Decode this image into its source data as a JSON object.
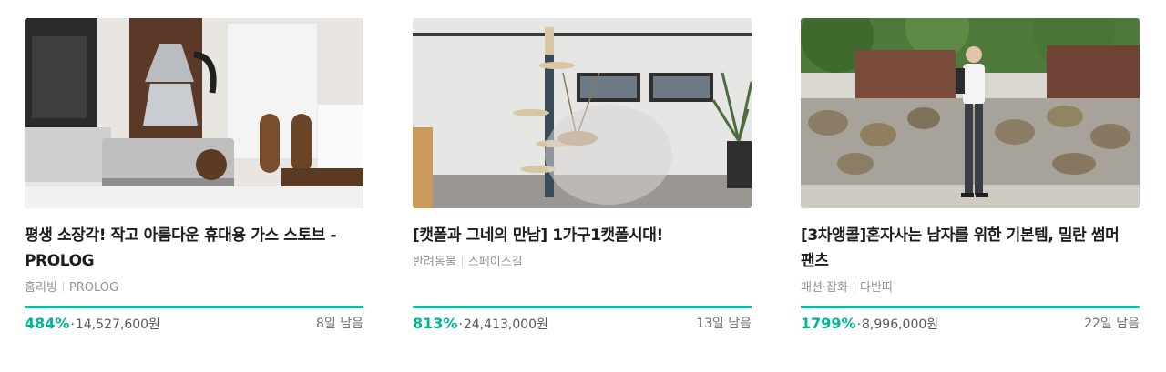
{
  "cards": [
    {
      "title": "평생 소장각! 작고 아름다운 휴대용 가스 스토브 - PROLOG",
      "category": "홈리빙",
      "maker": "PROLOG",
      "percent": "484%",
      "amount": "14,527,600원",
      "remaining": "8일 남음",
      "progress": 1.0,
      "image_alt": "moka pot on portable gas stove"
    },
    {
      "title": "[캣폴과 그네의 만남] 1가구1캣폴시대!",
      "category": "반려동물",
      "maker": "스페이스길",
      "percent": "813%",
      "amount": "24,413,000원",
      "remaining": "13일 남음",
      "progress": 1.0,
      "image_alt": "cat pole with hammock swing in room"
    },
    {
      "title": "[3차앵콜]혼자사는 남자를 위한 기본템, 밀란 썸머 팬츠",
      "category": "패션·잡화",
      "maker": "다반띠",
      "percent": "1799%",
      "amount": "8,996,000원",
      "remaining": "22일 남음",
      "progress": 1.0,
      "image_alt": "man standing in front of stone wall"
    }
  ],
  "colors": {
    "accent": "#00c4a1",
    "percent_text": "#00b694",
    "track": "#e6eaed"
  }
}
